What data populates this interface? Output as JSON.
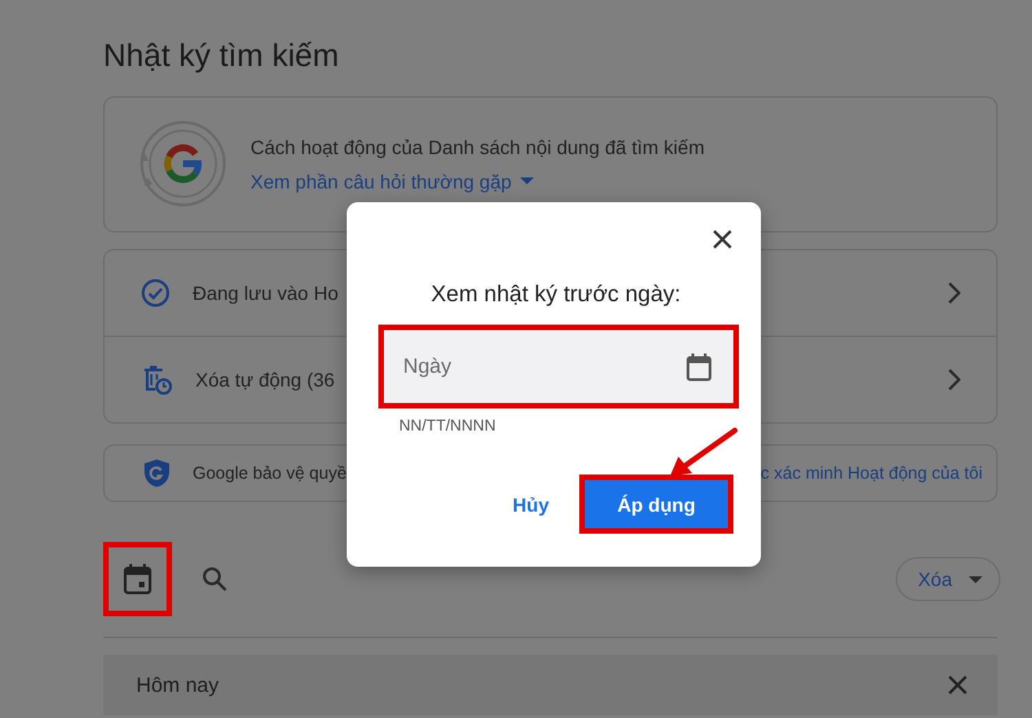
{
  "page_title": "Nhật ký tìm kiếm",
  "info_card": {
    "text": "Cách hoạt động của Danh sách nội dung đã tìm kiếm",
    "link": "Xem phần câu hỏi thường gặp"
  },
  "settings_rows": [
    {
      "label": "Đang lưu vào Ho"
    },
    {
      "label": "Xóa tự động (36"
    }
  ],
  "protection_card": {
    "text": "Google bảo vệ quyề",
    "link": "c xác minh Hoạt động của tôi"
  },
  "toolbar": {
    "delete_menu": "Xóa"
  },
  "day_group": {
    "label": "Hôm nay"
  },
  "dialog": {
    "title": "Xem nhật ký trước ngày:",
    "date_field": {
      "placeholder": "Ngày",
      "hint": "NN/TT/NNNN"
    },
    "buttons": [
      {
        "label": "Hủy",
        "kind": "text"
      },
      {
        "label": "Áp dụng",
        "kind": "filled"
      }
    ]
  }
}
